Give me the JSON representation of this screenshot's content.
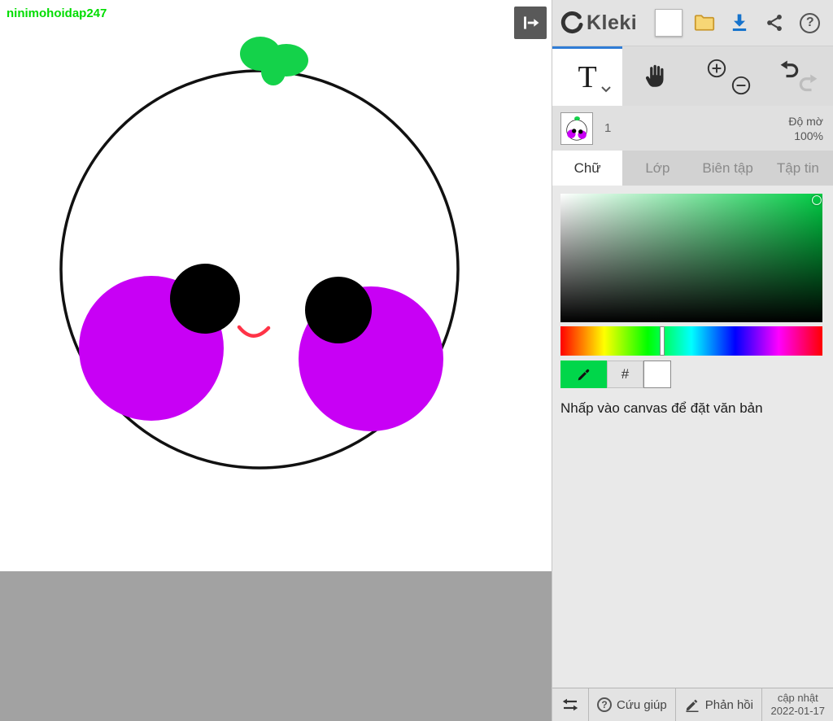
{
  "colors": {
    "accent_blue": "#2f7cd6",
    "primary_green": "#00d64a",
    "magenta": "#c800f5",
    "watermark_green": "#00dd00",
    "canvas_gray": "#a2a2a2"
  },
  "canvas": {
    "watermark": "ninimohoidap247"
  },
  "header": {
    "app_name": "Kleki"
  },
  "icons": {
    "question_mark": "?"
  },
  "tools": {
    "text_label": "T"
  },
  "layer_bar": {
    "layer_number": "1",
    "opacity_label": "Độ mờ",
    "opacity_value": "100%"
  },
  "tabs": [
    {
      "label": "Chữ"
    },
    {
      "label": "Lớp"
    },
    {
      "label": "Biên tập"
    },
    {
      "label": "Tập tin"
    }
  ],
  "color_panel": {
    "hex_label": "#"
  },
  "hint": "Nhấp vào canvas để đặt văn bản",
  "footer": {
    "help_label": "Cứu giúp",
    "feedback_label": "Phản hồi",
    "update_label": "cập nhật",
    "update_date": "2022-01-17"
  }
}
